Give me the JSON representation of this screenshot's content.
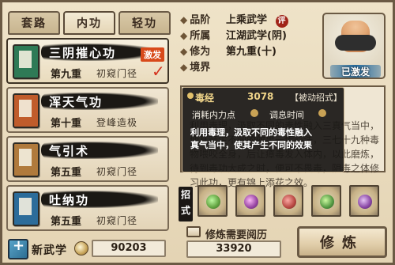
{
  "tabs": [
    {
      "label": "套路",
      "active": false
    },
    {
      "label": "内功",
      "active": true
    },
    {
      "label": "轻功",
      "active": false
    }
  ],
  "skills": [
    {
      "name": "三阴摧心功",
      "level": "第九重",
      "stage": "初窥门径",
      "selected": true,
      "badge": "激发",
      "book_color": "#2e7a56"
    },
    {
      "name": "浑天气功",
      "level": "第十重",
      "stage": "登峰造极",
      "selected": false,
      "badge": "",
      "book_color": "#c05c2b"
    },
    {
      "name": "气引术",
      "level": "第五重",
      "stage": "初窥门径",
      "selected": false,
      "badge": "",
      "book_color": "#b07a3c"
    },
    {
      "name": "吐纳功",
      "level": "第五重",
      "stage": "初窥门径",
      "selected": false,
      "badge": "",
      "book_color": "#2c6c9a"
    }
  ],
  "bottom_left": {
    "new_skill_label": "新武学",
    "coins": "90203"
  },
  "info": {
    "grade_label": "品阶",
    "grade_value": "上乘武学",
    "grade_badge": "评",
    "affiliation_label": "所属",
    "affiliation_value": "江湖武学(阴)",
    "cultivation_label": "修为",
    "cultivation_value": "第九重(十)",
    "realm_label": "境界",
    "realm_value": ""
  },
  "portrait": {
    "activated_label": "已激发"
  },
  "detail": {
    "desc": "利用毒理，汲取不同的毒性融入三真气当中，使其产生不同的效果一传心法，三七十九种毒物喂咬全身，后让瘴毒发入体内，以此磨炼，待到毒功大成之时，便可不畏毒，阴毒之体修习此功，更有锦上添花之效。"
  },
  "tooltip": {
    "title": "毒经",
    "number": "3078",
    "passive_label": "【被动招式】",
    "cost_label": "消耗内力点",
    "cooldown_label": "调息时间",
    "line1": "利用毒理，汲取不同的毒性融入",
    "line2": "真气当中，使其产生不同的效果"
  },
  "moves": {
    "label": "招式",
    "icons": [
      {
        "name": "move-1-icon"
      },
      {
        "name": "move-2-icon"
      },
      {
        "name": "move-3-icon"
      },
      {
        "name": "move-4-icon"
      },
      {
        "name": "move-5-icon"
      },
      {
        "name": "move-6-icon"
      }
    ]
  },
  "requirement": {
    "label": "修炼需要阅历",
    "value": "33920"
  },
  "train_button": "修炼"
}
